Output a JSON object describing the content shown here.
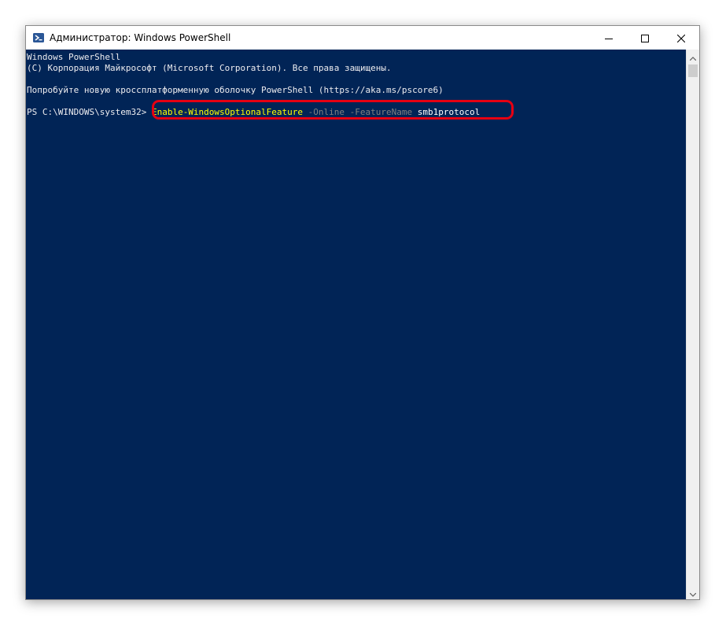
{
  "window": {
    "title": "Администратор: Windows PowerShell",
    "app_icon": "powershell-icon",
    "controls": {
      "minimize_icon": "minimize-icon",
      "maximize_icon": "maximize-icon",
      "close_icon": "close-icon"
    }
  },
  "console": {
    "lines": [
      "Windows PowerShell",
      "(C) Корпорация Майкрософт (Microsoft Corporation). Все права защищены.",
      "Попробуйте новую кроссплатформенную оболочку PowerShell (https://aka.ms/pscore6)"
    ],
    "prompt": "PS C:\\WINDOWS\\system32>",
    "command": {
      "cmdlet": "Enable-WindowsOptionalFeature",
      "param1": "-Online",
      "param2": "-FeatureName",
      "argument": "smb1protocol"
    }
  },
  "colors": {
    "console_background": "#012456",
    "cmdlet": "#ffff00",
    "parameter": "#808080",
    "highlight_border": "#e60012"
  }
}
